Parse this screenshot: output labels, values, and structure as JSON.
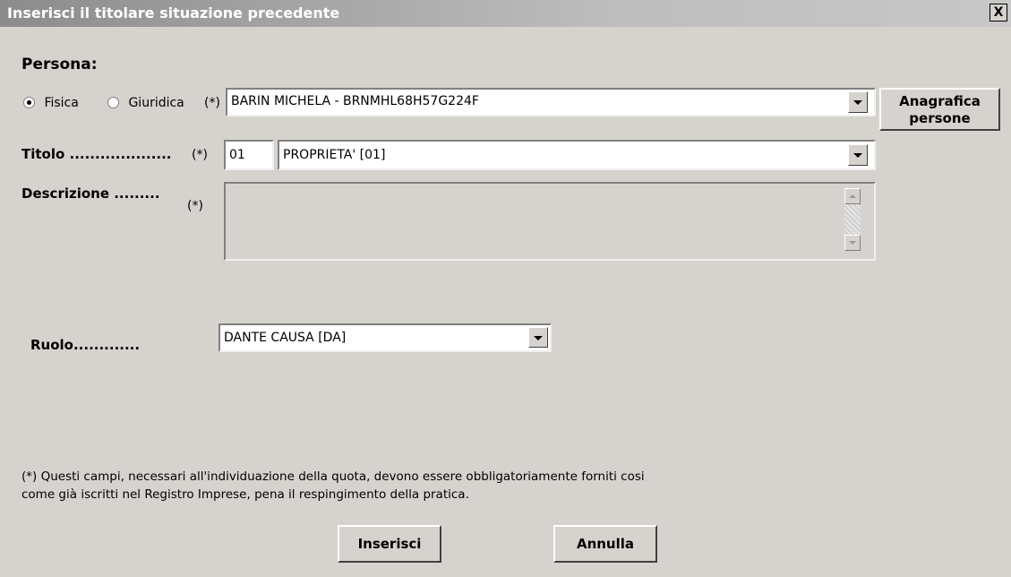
{
  "window": {
    "title": "Inserisci il titolare situazione precedente",
    "close_label": "X"
  },
  "persona": {
    "heading": "Persona:",
    "radio_fisica": "Fisica",
    "radio_giuridica": "Giuridica",
    "required_mark": "(*)",
    "selected_type": "Fisica",
    "value": "BARIN MICHELA - BRNMHL68H57G224F"
  },
  "anagrafica_button": {
    "line1": "Anagrafica",
    "line2": "persone"
  },
  "titolo": {
    "label": "Titolo ....................",
    "required_mark": "(*)",
    "code": "01",
    "value": "PROPRIETA' [01]"
  },
  "descrizione": {
    "label": "Descrizione .........",
    "required_mark": "(*)",
    "value": ""
  },
  "ruolo": {
    "label": "Ruolo.............",
    "value": "DANTE CAUSA [DA]"
  },
  "note": {
    "line1": "(*) Questi campi, necessari all'individuazione della quota, devono essere obbligatoriamente forniti cosi",
    "line2": "come già iscritti nel Registro Imprese, pena il respingimento della pratica."
  },
  "buttons": {
    "insert": "Inserisci",
    "cancel": "Annulla"
  }
}
